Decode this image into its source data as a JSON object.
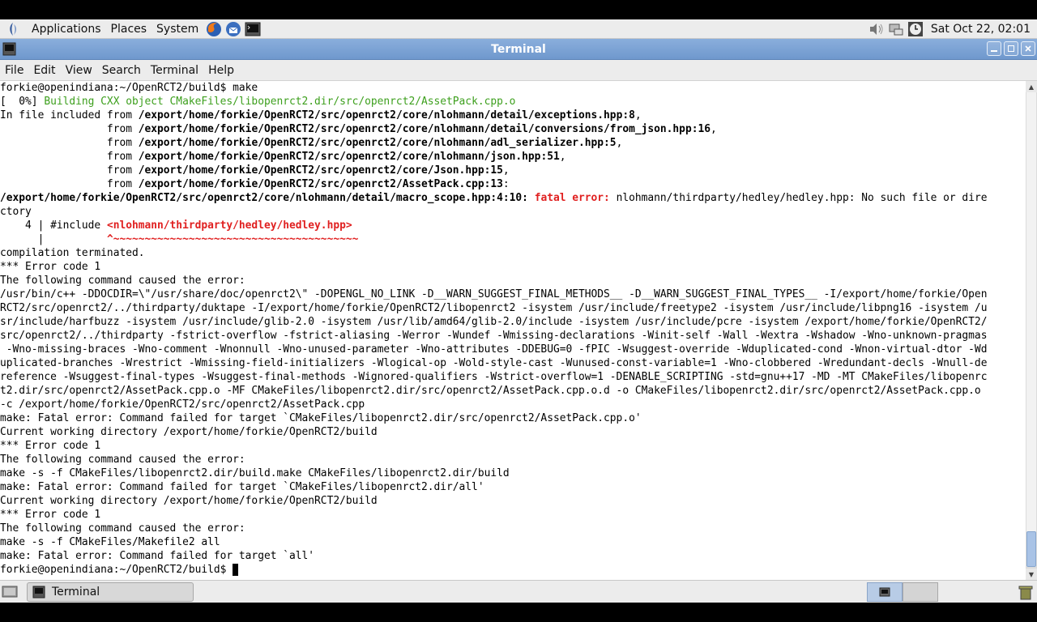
{
  "top_panel": {
    "menus": [
      "Applications",
      "Places",
      "System"
    ],
    "clock": "Sat Oct 22, 02:01",
    "launchers": [
      "firefox-icon",
      "thunderbird-icon",
      "terminal-icon"
    ],
    "tray_icons": [
      "volume-icon",
      "network-icon",
      "clock-icon"
    ]
  },
  "window": {
    "title": "Terminal",
    "menu": [
      "File",
      "Edit",
      "View",
      "Search",
      "Terminal",
      "Help"
    ]
  },
  "terminal": {
    "lines": [
      {
        "segments": [
          {
            "t": "forkie@openindiana:~/OpenRCT2/build$ make"
          }
        ]
      },
      {
        "segments": [
          {
            "t": "[  0%] "
          },
          {
            "t": "Building CXX object CMakeFiles/libopenrct2.dir/src/openrct2/AssetPack.cpp.o",
            "c": "g"
          }
        ]
      },
      {
        "segments": [
          {
            "t": "In file included from "
          },
          {
            "t": "/export/home/forkie/OpenRCT2/src/openrct2/core/nlohmann/detail/exceptions.hpp:8",
            "c": "b"
          },
          {
            "t": ","
          }
        ]
      },
      {
        "segments": [
          {
            "t": "                 from "
          },
          {
            "t": "/export/home/forkie/OpenRCT2/src/openrct2/core/nlohmann/detail/conversions/from_json.hpp:16",
            "c": "b"
          },
          {
            "t": ","
          }
        ]
      },
      {
        "segments": [
          {
            "t": "                 from "
          },
          {
            "t": "/export/home/forkie/OpenRCT2/src/openrct2/core/nlohmann/adl_serializer.hpp:5",
            "c": "b"
          },
          {
            "t": ","
          }
        ]
      },
      {
        "segments": [
          {
            "t": "                 from "
          },
          {
            "t": "/export/home/forkie/OpenRCT2/src/openrct2/core/nlohmann/json.hpp:51",
            "c": "b"
          },
          {
            "t": ","
          }
        ]
      },
      {
        "segments": [
          {
            "t": "                 from "
          },
          {
            "t": "/export/home/forkie/OpenRCT2/src/openrct2/core/Json.hpp:15",
            "c": "b"
          },
          {
            "t": ","
          }
        ]
      },
      {
        "segments": [
          {
            "t": "                 from "
          },
          {
            "t": "/export/home/forkie/OpenRCT2/src/openrct2/AssetPack.cpp:13",
            "c": "b"
          },
          {
            "t": ":"
          }
        ]
      },
      {
        "segments": [
          {
            "t": "/export/home/forkie/OpenRCT2/src/openrct2/core/nlohmann/detail/macro_scope.hpp:4:10:",
            "c": "b"
          },
          {
            "t": " "
          },
          {
            "t": "fatal error:",
            "c": "r"
          },
          {
            "t": " nlohmann/thirdparty/hedley/hedley.hpp: No such file or dire"
          }
        ]
      },
      {
        "segments": [
          {
            "t": "ctory"
          }
        ]
      },
      {
        "segments": [
          {
            "t": "    4 | #include "
          },
          {
            "t": "<nlohmann/thirdparty/hedley/hedley.hpp>",
            "c": "r"
          }
        ]
      },
      {
        "segments": [
          {
            "t": "      |          "
          },
          {
            "t": "^~~~~~~~~~~~~~~~~~~~~~~~~~~~~~~~~~~~~~~~",
            "c": "r"
          }
        ]
      },
      {
        "segments": [
          {
            "t": "compilation terminated."
          }
        ]
      },
      {
        "segments": [
          {
            "t": "*** Error code 1"
          }
        ]
      },
      {
        "segments": [
          {
            "t": "The following command caused the error:"
          }
        ]
      },
      {
        "segments": [
          {
            "t": "/usr/bin/c++ -DDOCDIR=\\\"/usr/share/doc/openrct2\\\" -DOPENGL_NO_LINK -D__WARN_SUGGEST_FINAL_METHODS__ -D__WARN_SUGGEST_FINAL_TYPES__ -I/export/home/forkie/Open"
          }
        ]
      },
      {
        "segments": [
          {
            "t": "RCT2/src/openrct2/../thirdparty/duktape -I/export/home/forkie/OpenRCT2/libopenrct2 -isystem /usr/include/freetype2 -isystem /usr/include/libpng16 -isystem /u"
          }
        ]
      },
      {
        "segments": [
          {
            "t": "sr/include/harfbuzz -isystem /usr/include/glib-2.0 -isystem /usr/lib/amd64/glib-2.0/include -isystem /usr/include/pcre -isystem /export/home/forkie/OpenRCT2/"
          }
        ]
      },
      {
        "segments": [
          {
            "t": "src/openrct2/../thirdparty -fstrict-overflow -fstrict-aliasing -Werror -Wundef -Wmissing-declarations -Winit-self -Wall -Wextra -Wshadow -Wno-unknown-pragmas"
          }
        ]
      },
      {
        "segments": [
          {
            "t": " -Wno-missing-braces -Wno-comment -Wnonnull -Wno-unused-parameter -Wno-attributes -DDEBUG=0 -fPIC -Wsuggest-override -Wduplicated-cond -Wnon-virtual-dtor -Wd"
          }
        ]
      },
      {
        "segments": [
          {
            "t": "uplicated-branches -Wrestrict -Wmissing-field-initializers -Wlogical-op -Wold-style-cast -Wunused-const-variable=1 -Wno-clobbered -Wredundant-decls -Wnull-de"
          }
        ]
      },
      {
        "segments": [
          {
            "t": "reference -Wsuggest-final-types -Wsuggest-final-methods -Wignored-qualifiers -Wstrict-overflow=1 -DENABLE_SCRIPTING -std=gnu++17 -MD -MT CMakeFiles/libopenrc"
          }
        ]
      },
      {
        "segments": [
          {
            "t": "t2.dir/src/openrct2/AssetPack.cpp.o -MF CMakeFiles/libopenrct2.dir/src/openrct2/AssetPack.cpp.o.d -o CMakeFiles/libopenrct2.dir/src/openrct2/AssetPack.cpp.o"
          }
        ]
      },
      {
        "segments": [
          {
            "t": "-c /export/home/forkie/OpenRCT2/src/openrct2/AssetPack.cpp"
          }
        ]
      },
      {
        "segments": [
          {
            "t": "make: Fatal error: Command failed for target `CMakeFiles/libopenrct2.dir/src/openrct2/AssetPack.cpp.o'"
          }
        ]
      },
      {
        "segments": [
          {
            "t": "Current working directory /export/home/forkie/OpenRCT2/build"
          }
        ]
      },
      {
        "segments": [
          {
            "t": "*** Error code 1"
          }
        ]
      },
      {
        "segments": [
          {
            "t": "The following command caused the error:"
          }
        ]
      },
      {
        "segments": [
          {
            "t": "make -s -f CMakeFiles/libopenrct2.dir/build.make CMakeFiles/libopenrct2.dir/build"
          }
        ]
      },
      {
        "segments": [
          {
            "t": "make: Fatal error: Command failed for target `CMakeFiles/libopenrct2.dir/all'"
          }
        ]
      },
      {
        "segments": [
          {
            "t": "Current working directory /export/home/forkie/OpenRCT2/build"
          }
        ]
      },
      {
        "segments": [
          {
            "t": "*** Error code 1"
          }
        ]
      },
      {
        "segments": [
          {
            "t": "The following command caused the error:"
          }
        ]
      },
      {
        "segments": [
          {
            "t": "make -s -f CMakeFiles/Makefile2 all"
          }
        ]
      },
      {
        "segments": [
          {
            "t": "make: Fatal error: Command failed for target `all'"
          }
        ]
      },
      {
        "segments": [
          {
            "t": "forkie@openindiana:~/OpenRCT2/build$ "
          }
        ],
        "cursor": true
      }
    ]
  },
  "taskbar": {
    "task_label": "Terminal"
  },
  "colors": {
    "titlebar": "#7aa2d4",
    "build_green": "#3c9f1c",
    "error_red": "#e02020"
  }
}
